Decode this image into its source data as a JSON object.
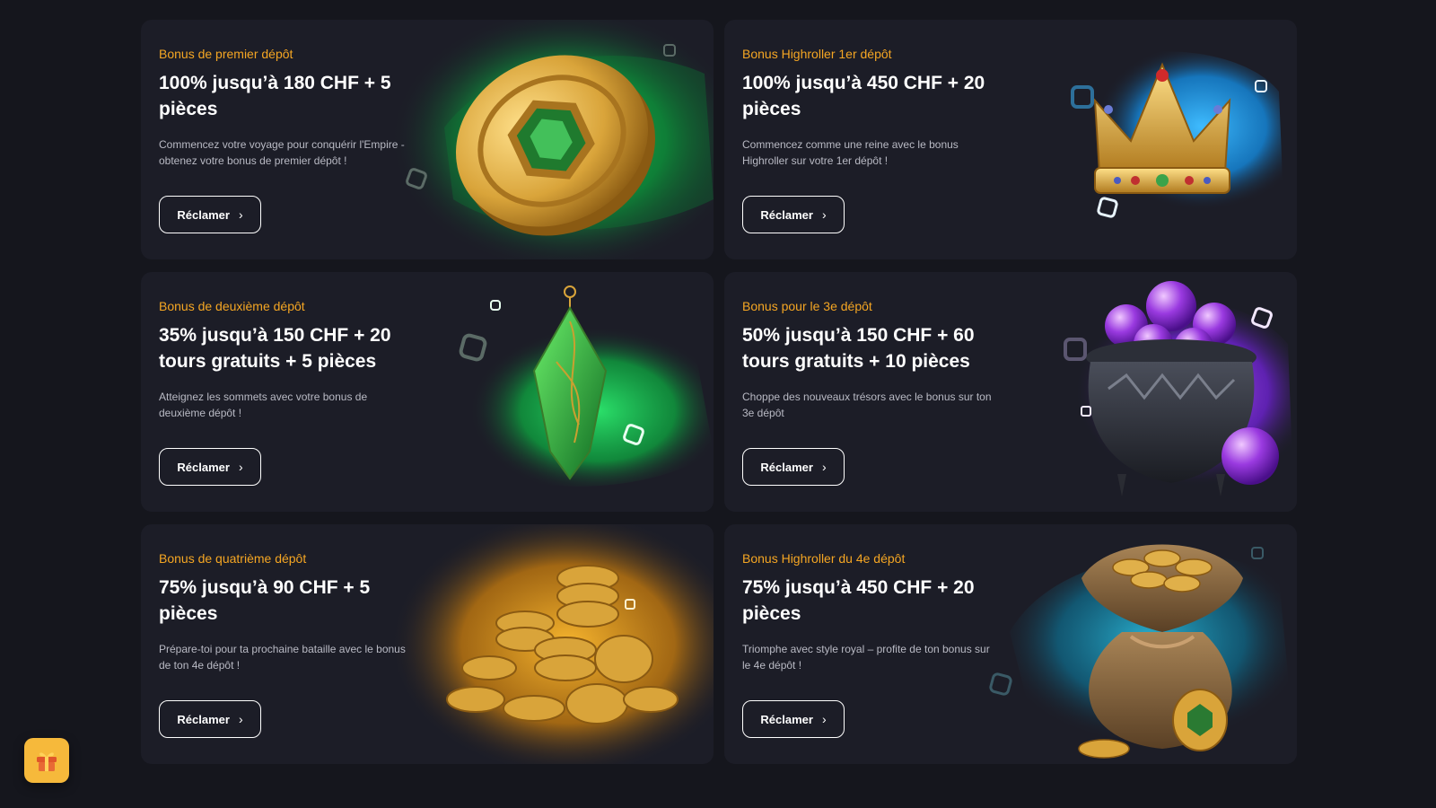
{
  "cards": [
    {
      "eyebrow": "Bonus de premier dépôt",
      "title": "100% jusqu’à 180 CHF + 5 pièces",
      "description": "Commencez votre voyage pour conquérir l'Empire - obtenez votre bonus de premier dépôt !",
      "button": "Réclamer",
      "art": "gold-coin-emerald-icon",
      "glow": "#1fd15a"
    },
    {
      "eyebrow": "Bonus Highroller 1er dépôt",
      "title": "100% jusqu’à 450 CHF + 20 pièces",
      "description": "Commencez comme une reine avec le bonus Highroller sur votre 1er dépôt !",
      "button": "Réclamer",
      "art": "crown-icon",
      "glow": "#1aa3f0"
    },
    {
      "eyebrow": "Bonus de deuxième dépôt",
      "title": "35% jusqu’à 150 CHF + 20 tours gratuits + 5 pièces",
      "description": "Atteignez les sommets avec votre bonus de deuxième dépôt !",
      "button": "Réclamer",
      "art": "emerald-pendant-icon",
      "glow": "#1fd15a"
    },
    {
      "eyebrow": "Bonus pour le 3e dépôt",
      "title": "50% jusqu’à 150 CHF + 60 tours gratuits + 10 pièces",
      "description": "Choppe des nouveaux trésors avec le bonus sur ton 3e dépôt",
      "button": "Réclamer",
      "art": "cauldron-orbs-icon",
      "glow": "#8a3cf0"
    },
    {
      "eyebrow": "Bonus de quatrième dépôt",
      "title": "75% jusqu’à 90 CHF + 5 pièces",
      "description": "Prépare-toi pour ta prochaine bataille avec le bonus de ton 4e dépôt !",
      "button": "Réclamer",
      "art": "coin-stacks-icon",
      "glow": "#f0a020"
    },
    {
      "eyebrow": "Bonus Highroller du 4e dépôt",
      "title": "75% jusqu’à 450 CHF + 20 pièces",
      "description": "Triomphe avec style royal – profite de ton bonus sur le 4e dépôt !",
      "button": "Réclamer",
      "art": "coin-sack-icon",
      "glow": "#1aa3c0"
    }
  ],
  "colors": {
    "page_bg": "#15161d",
    "card_bg": "#1c1d27",
    "accent": "#f5a623",
    "gift_button": "#f6b93b"
  },
  "floating": {
    "gift_icon": "gift-icon"
  }
}
